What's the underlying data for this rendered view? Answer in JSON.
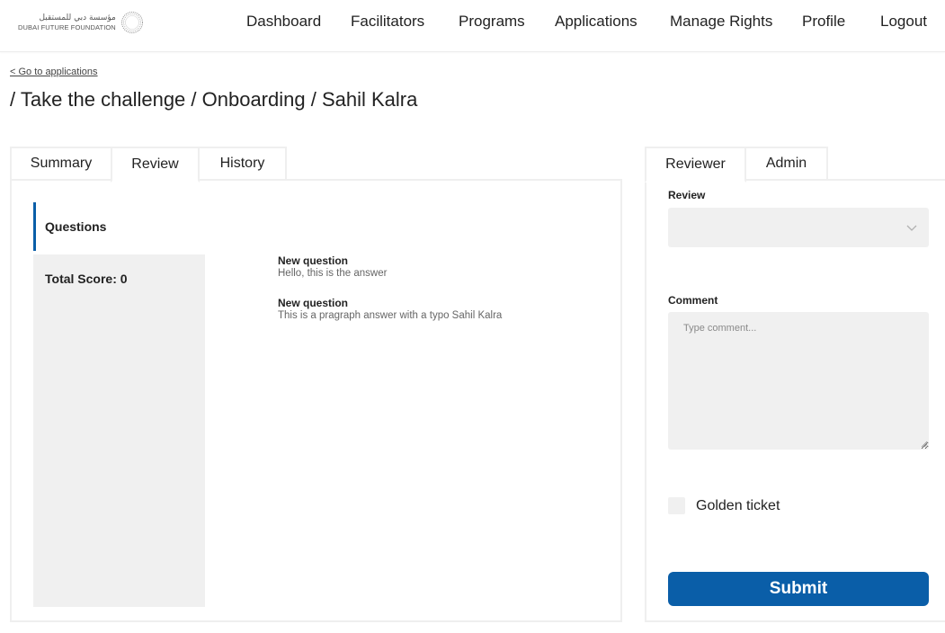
{
  "logo": {
    "arabic_text": "مؤسسة دبي للمستقبل",
    "english_text": "DUBAI FUTURE FOUNDATION"
  },
  "nav": {
    "items": [
      {
        "label": "Dashboard"
      },
      {
        "label": "Facilitators"
      },
      {
        "label": "Programs"
      },
      {
        "label": "Applications"
      },
      {
        "label": "Manage Rights"
      },
      {
        "label": "Profile"
      },
      {
        "label": "Logout"
      }
    ]
  },
  "breadcrumb": {
    "back_link": "< Go to applications",
    "title": "/ Take the challenge / Onboarding / Sahil Kalra"
  },
  "left_tabs": [
    {
      "label": "Summary",
      "active": false
    },
    {
      "label": "Review",
      "active": true
    },
    {
      "label": "History",
      "active": false
    }
  ],
  "questions": {
    "header": "Questions",
    "total_score": "Total Score: 0",
    "items": [
      {
        "question": "New question",
        "answer": "Hello, this is the answer"
      },
      {
        "question": "New question",
        "answer": "This is a pragraph answer with a typo Sahil Kalra"
      }
    ]
  },
  "right_tabs": [
    {
      "label": "Reviewer",
      "active": true
    },
    {
      "label": "Admin",
      "active": false
    }
  ],
  "review_form": {
    "review_label": "Review",
    "review_value": "",
    "comment_label": "Comment",
    "comment_placeholder": "Type comment...",
    "golden_ticket_label": "Golden ticket",
    "golden_ticket_checked": false,
    "submit_label": "Submit"
  },
  "colors": {
    "accent": "#0a5ea8",
    "panel_border": "#efefef",
    "field_bg": "#f0f0f0"
  }
}
